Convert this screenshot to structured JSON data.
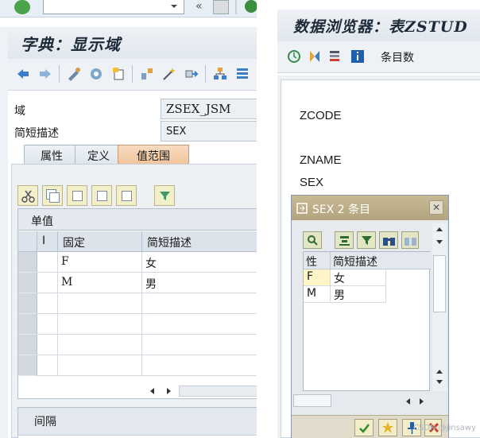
{
  "toolbar": {
    "command_field": "",
    "back_glyph": "«"
  },
  "left_window": {
    "title": "字典：显示域",
    "fields": [
      {
        "label": "域",
        "value": "ZSEX_JSM"
      },
      {
        "label": "简短描述",
        "value": "SEX"
      }
    ],
    "tabs": [
      {
        "label": "属性"
      },
      {
        "label": "定义"
      },
      {
        "label": "值范围",
        "active": true
      }
    ],
    "single_values": {
      "title": "单值",
      "columns": [
        "I",
        "固定",
        "简短描述"
      ],
      "rows": [
        {
          "fixed": "F",
          "desc": "女"
        },
        {
          "fixed": "M",
          "desc": "男"
        }
      ]
    },
    "intervals_title": "间隔"
  },
  "right_window": {
    "title": "数据浏览器：表ZSTUD",
    "entries_label": "条目数",
    "field_labels": [
      "ZCODE",
      "ZNAME",
      "SEX"
    ]
  },
  "popup": {
    "title": "SEX 2 条目",
    "close_glyph": "✕",
    "columns": [
      "性别",
      "简短描述"
    ],
    "rows": [
      {
        "key": "F",
        "desc": "女"
      },
      {
        "key": "M",
        "desc": "男"
      }
    ]
  },
  "watermark": "CSDN @jinsawy",
  "colors": {
    "active_tab": "#f1c49c",
    "popup_title": "#b2a47e",
    "key_cell": "#fdf5c7"
  }
}
